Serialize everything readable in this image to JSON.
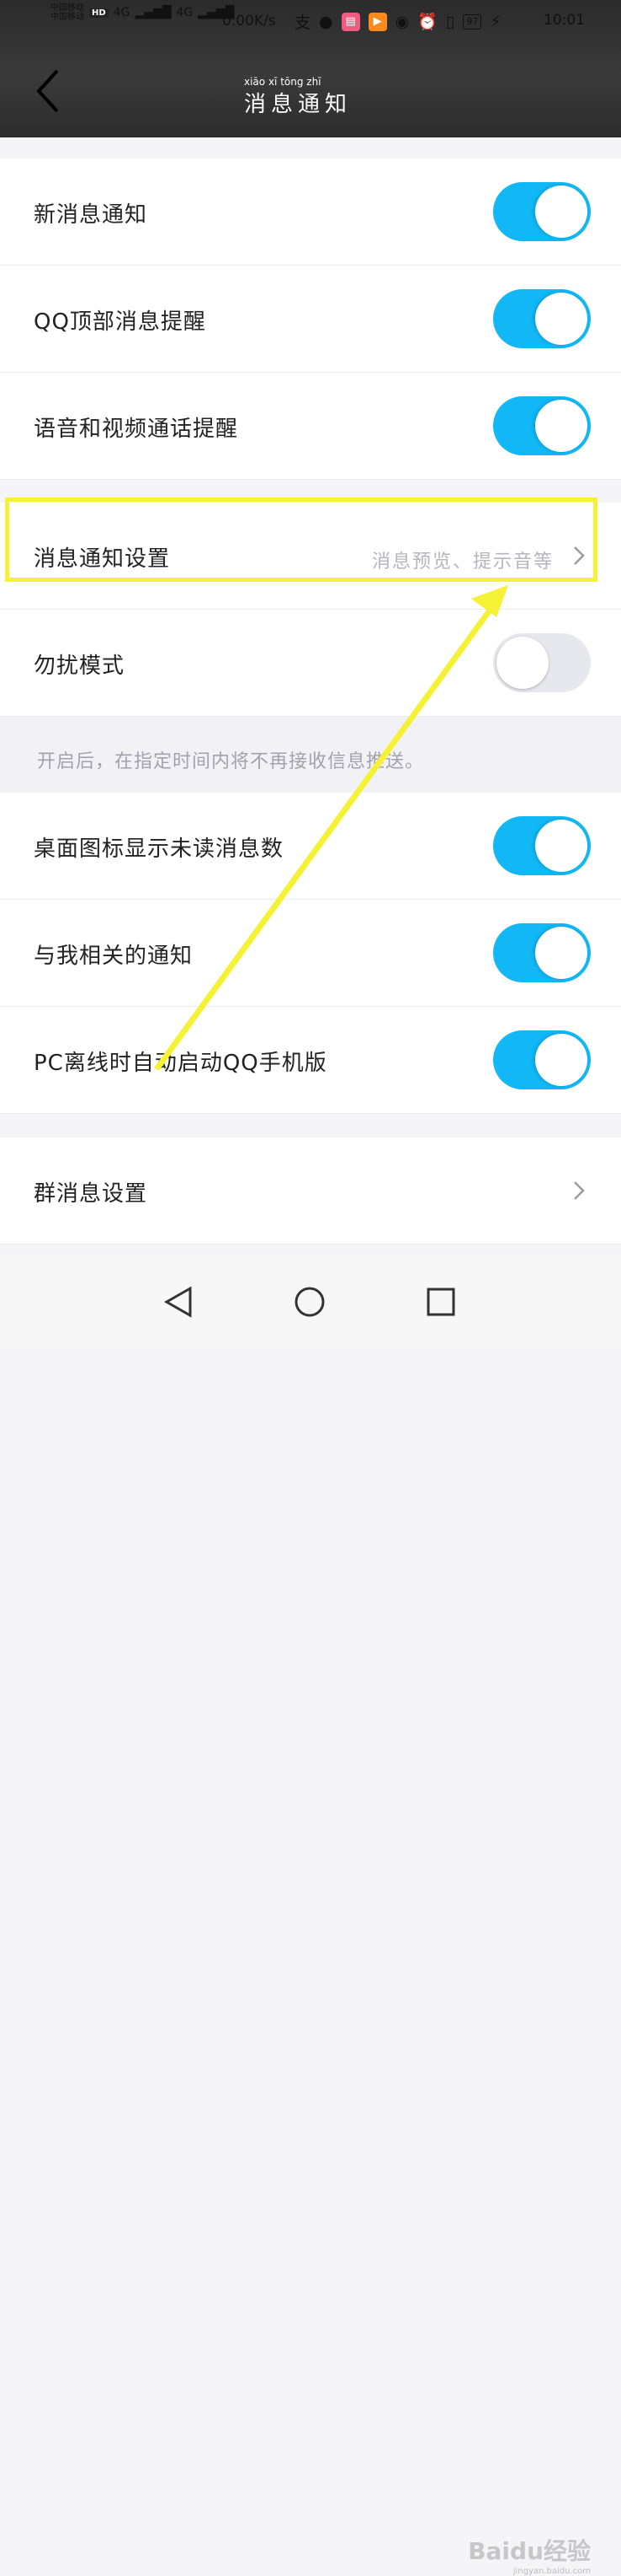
{
  "status_bar": {
    "carrier1": "中国移动",
    "carrier2": "中国移动",
    "hd": "HD",
    "network": "4G",
    "speed": "0.00K/s",
    "battery": "97",
    "time": "10:01"
  },
  "header": {
    "title": "消息通知"
  },
  "settings": {
    "new_message": {
      "label": "新消息通知",
      "enabled": true
    },
    "qq_top_alert": {
      "label": "QQ顶部消息提醒",
      "enabled": true
    },
    "voice_video_alert": {
      "label": "语音和视频通话提醒",
      "enabled": true
    },
    "notification_settings": {
      "label": "消息通知设置",
      "sub": "消息预览、提示音等"
    },
    "do_not_disturb": {
      "label": "勿扰模式",
      "enabled": false
    },
    "dnd_hint": "开启后，在指定时间内将不再接收信息推送。",
    "unread_badge": {
      "label": "桌面图标显示未读消息数",
      "enabled": true
    },
    "related_notify": {
      "label": "与我相关的通知",
      "enabled": true
    },
    "pc_offline": {
      "label": "PC离线时自动启动QQ手机版",
      "enabled": true
    },
    "group_settings": {
      "label": "群消息设置"
    }
  },
  "watermark": {
    "text": "Baidu经验",
    "url": "jingyan.baidu.com"
  },
  "colors": {
    "toggle_on": "#12b7f5",
    "toggle_off": "#e6e8ee",
    "highlight": "#f5f235"
  }
}
